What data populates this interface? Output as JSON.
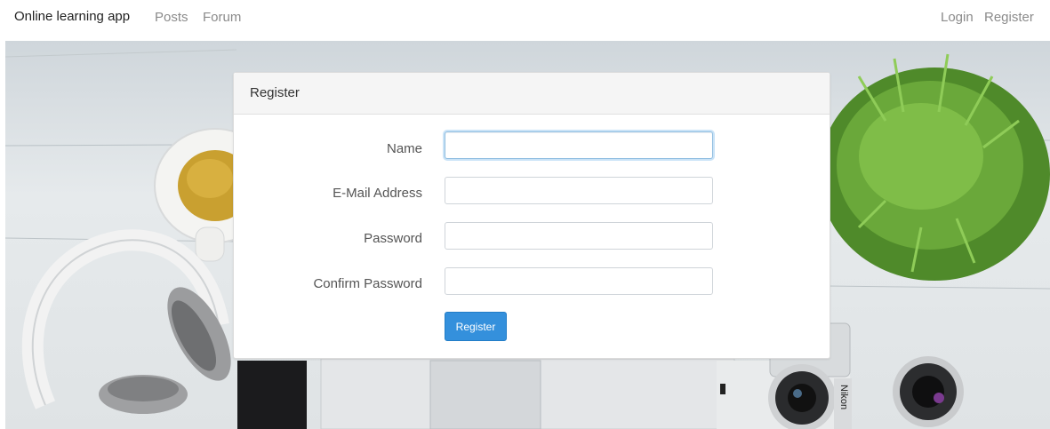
{
  "navbar": {
    "brand": "Online learning app",
    "left_links": [
      "Posts",
      "Forum"
    ],
    "right_links": [
      "Login",
      "Register"
    ]
  },
  "panel": {
    "heading": "Register",
    "fields": [
      {
        "label": "Name",
        "value": ""
      },
      {
        "label": "E-Mail Address",
        "value": ""
      },
      {
        "label": "Password",
        "value": ""
      },
      {
        "label": "Confirm Password",
        "value": ""
      }
    ],
    "submit_label": "Register"
  },
  "background": {
    "camera_brand": "Nikon"
  },
  "colors": {
    "primary": "#3490dc",
    "nav_muted": "#8b8b8b",
    "focus": "#66afe9"
  }
}
